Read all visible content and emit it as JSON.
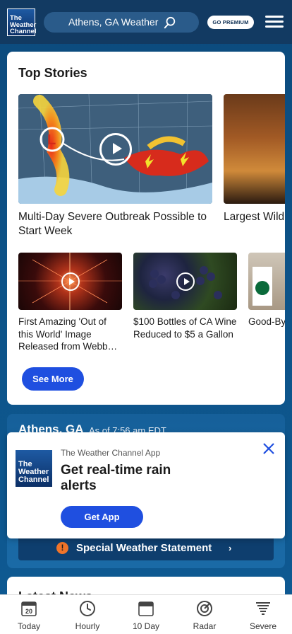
{
  "header": {
    "logo_text": [
      "The",
      "Weather",
      "Channel"
    ],
    "search_text": "Athens, GA Weather",
    "premium_label": "GO PREMIUM"
  },
  "top_stories": {
    "title": "Top Stories",
    "lead": {
      "headline": "Multi-Day Severe Outbreak Possible to Start Week"
    },
    "lead2": {
      "headline": "Largest Wild Continues to"
    },
    "items": [
      {
        "headline": "First Amazing 'Out of this World' Image Released from Webb…"
      },
      {
        "headline": "$100 Bottles of CA Wine Reduced to $5 a Gallon"
      },
      {
        "headline": "Good-By Cups at S"
      }
    ],
    "see_more": "See More"
  },
  "weather_card": {
    "city": "Athens, GA",
    "as_of": "As of 7:56 am EDT",
    "special_statement": "Special Weather Statement",
    "special_icon": "!"
  },
  "popup": {
    "app_name": "The Weather Channel App",
    "title": "Get real-time rain alerts",
    "button": "Get App",
    "logo_text": [
      "The",
      "Weather",
      "Channel"
    ]
  },
  "latest": {
    "title": "Latest News"
  },
  "nav": [
    {
      "label": "Today",
      "icon": "calendar-today-icon",
      "day": "20"
    },
    {
      "label": "Hourly",
      "icon": "clock-icon"
    },
    {
      "label": "10 Day",
      "icon": "calendar-icon"
    },
    {
      "label": "Radar",
      "icon": "radar-icon"
    },
    {
      "label": "Severe",
      "icon": "tornado-icon"
    }
  ],
  "colors": {
    "accent": "#1f4fe0",
    "header_bg": "#123a62",
    "alert_orange": "#f0742a"
  }
}
